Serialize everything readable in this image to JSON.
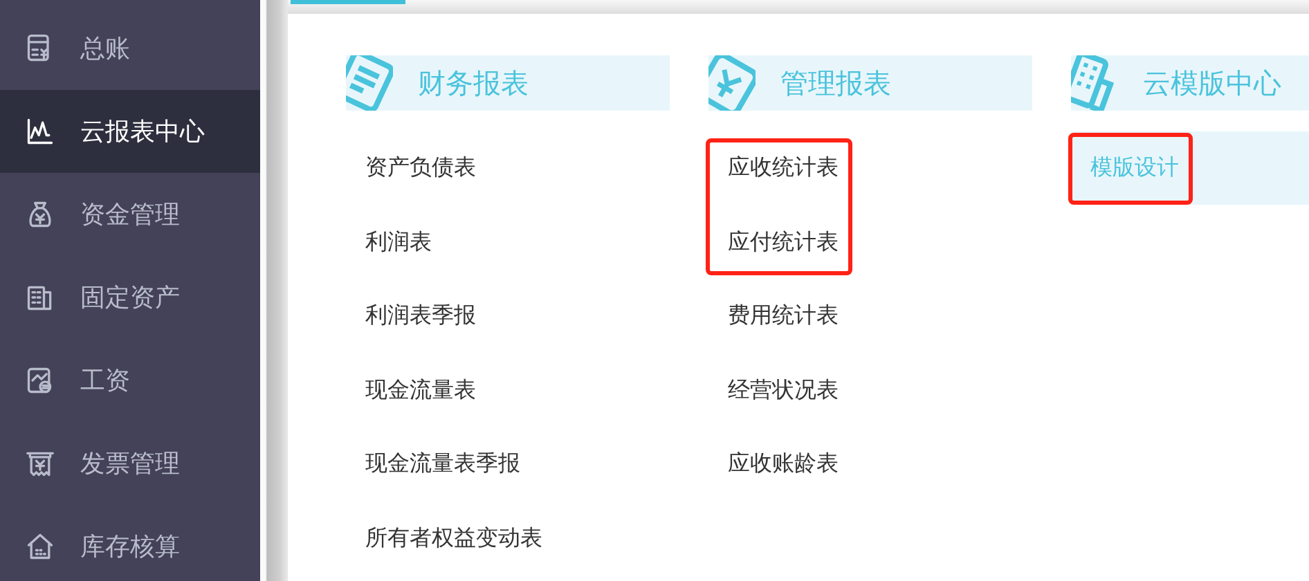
{
  "sidebar": {
    "items": [
      {
        "label": "总账",
        "kind": "ledger",
        "selected": false
      },
      {
        "label": "云报表中心",
        "kind": "chart",
        "selected": true
      },
      {
        "label": "资金管理",
        "kind": "moneybag",
        "selected": false
      },
      {
        "label": "固定资产",
        "kind": "building",
        "selected": false
      },
      {
        "label": "工资",
        "kind": "salary",
        "selected": false
      },
      {
        "label": "发票管理",
        "kind": "invoice",
        "selected": false
      },
      {
        "label": "库存核算",
        "kind": "house",
        "selected": false
      }
    ]
  },
  "sections": [
    {
      "title": "财务报表",
      "kind": "notepad",
      "items": [
        {
          "label": "资产负债表",
          "selected": false,
          "highlighted": false
        },
        {
          "label": "利润表",
          "selected": false,
          "highlighted": false
        },
        {
          "label": "利润表季报",
          "selected": false,
          "highlighted": false
        },
        {
          "label": "现金流量表",
          "selected": false,
          "highlighted": false
        },
        {
          "label": "现金流量表季报",
          "selected": false,
          "highlighted": false
        },
        {
          "label": "所有者权益变动表",
          "selected": false,
          "highlighted": false
        }
      ]
    },
    {
      "title": "管理报表",
      "kind": "yencard",
      "items": [
        {
          "label": "应收统计表",
          "selected": false,
          "highlighted": true
        },
        {
          "label": "应付统计表",
          "selected": false,
          "highlighted": true
        },
        {
          "label": "费用统计表",
          "selected": false,
          "highlighted": false
        },
        {
          "label": "经营状况表",
          "selected": false,
          "highlighted": false
        },
        {
          "label": "应收账龄表",
          "selected": false,
          "highlighted": false
        }
      ]
    },
    {
      "title": "云模版中心",
      "kind": "office",
      "items": [
        {
          "label": "模版设计",
          "selected": true,
          "highlighted": true
        }
      ]
    }
  ]
}
